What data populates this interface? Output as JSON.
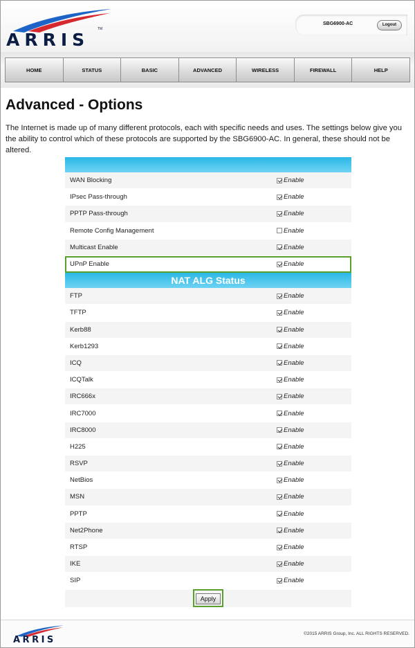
{
  "header": {
    "logo_text": "ARRIS",
    "logo_tm": "TM",
    "device_name": "SBG6900-AC",
    "logout_label": "Logout"
  },
  "nav": {
    "items": [
      "HOME",
      "STATUS",
      "BASIC",
      "ADVANCED",
      "WIRELESS",
      "FIREWALL",
      "HELP"
    ]
  },
  "page": {
    "title": "Advanced - Options",
    "intro": "The Internet is made up of many different protocols, each with specific needs and uses. The settings below give you the ability to control which of these protocols are supported by the SBG6900-AC. In general, these should not be altered."
  },
  "options": {
    "enable_label": "Enable",
    "rows": [
      {
        "label": "WAN Blocking",
        "checked": true
      },
      {
        "label": "IPsec Pass-through",
        "checked": true
      },
      {
        "label": "PPTP Pass-through",
        "checked": true
      },
      {
        "label": "Remote Config Management",
        "checked": false
      },
      {
        "label": "Multicast Enable",
        "checked": true
      },
      {
        "label": "UPnP Enable",
        "checked": true
      }
    ]
  },
  "nat_alg": {
    "title": "NAT ALG Status",
    "rows": [
      {
        "label": "FTP",
        "checked": true
      },
      {
        "label": "TFTP",
        "checked": true
      },
      {
        "label": "Kerb88",
        "checked": true
      },
      {
        "label": "Kerb1293",
        "checked": true
      },
      {
        "label": "ICQ",
        "checked": true
      },
      {
        "label": "ICQTalk",
        "checked": true
      },
      {
        "label": "IRC666x",
        "checked": true
      },
      {
        "label": "IRC7000",
        "checked": true
      },
      {
        "label": "IRC8000",
        "checked": true
      },
      {
        "label": "H225",
        "checked": true
      },
      {
        "label": "RSVP",
        "checked": true
      },
      {
        "label": "NetBios",
        "checked": true
      },
      {
        "label": "MSN",
        "checked": true
      },
      {
        "label": "PPTP",
        "checked": true
      },
      {
        "label": "Net2Phone",
        "checked": true
      },
      {
        "label": "RTSP",
        "checked": true
      },
      {
        "label": "IKE",
        "checked": true
      },
      {
        "label": "SIP",
        "checked": true
      }
    ]
  },
  "apply_label": "Apply",
  "footer": {
    "logo_text": "ARRIS",
    "copyright": "©2015 ARRIS Group, Inc. ALL RIGHTS RESERVED."
  },
  "colors": {
    "accent_blue": "#2ab8e6",
    "highlight_green": "#5a9e2e",
    "logo_navy": "#0b1d44",
    "swoosh_blue": "#1e64c8",
    "swoosh_red": "#d6282f"
  }
}
